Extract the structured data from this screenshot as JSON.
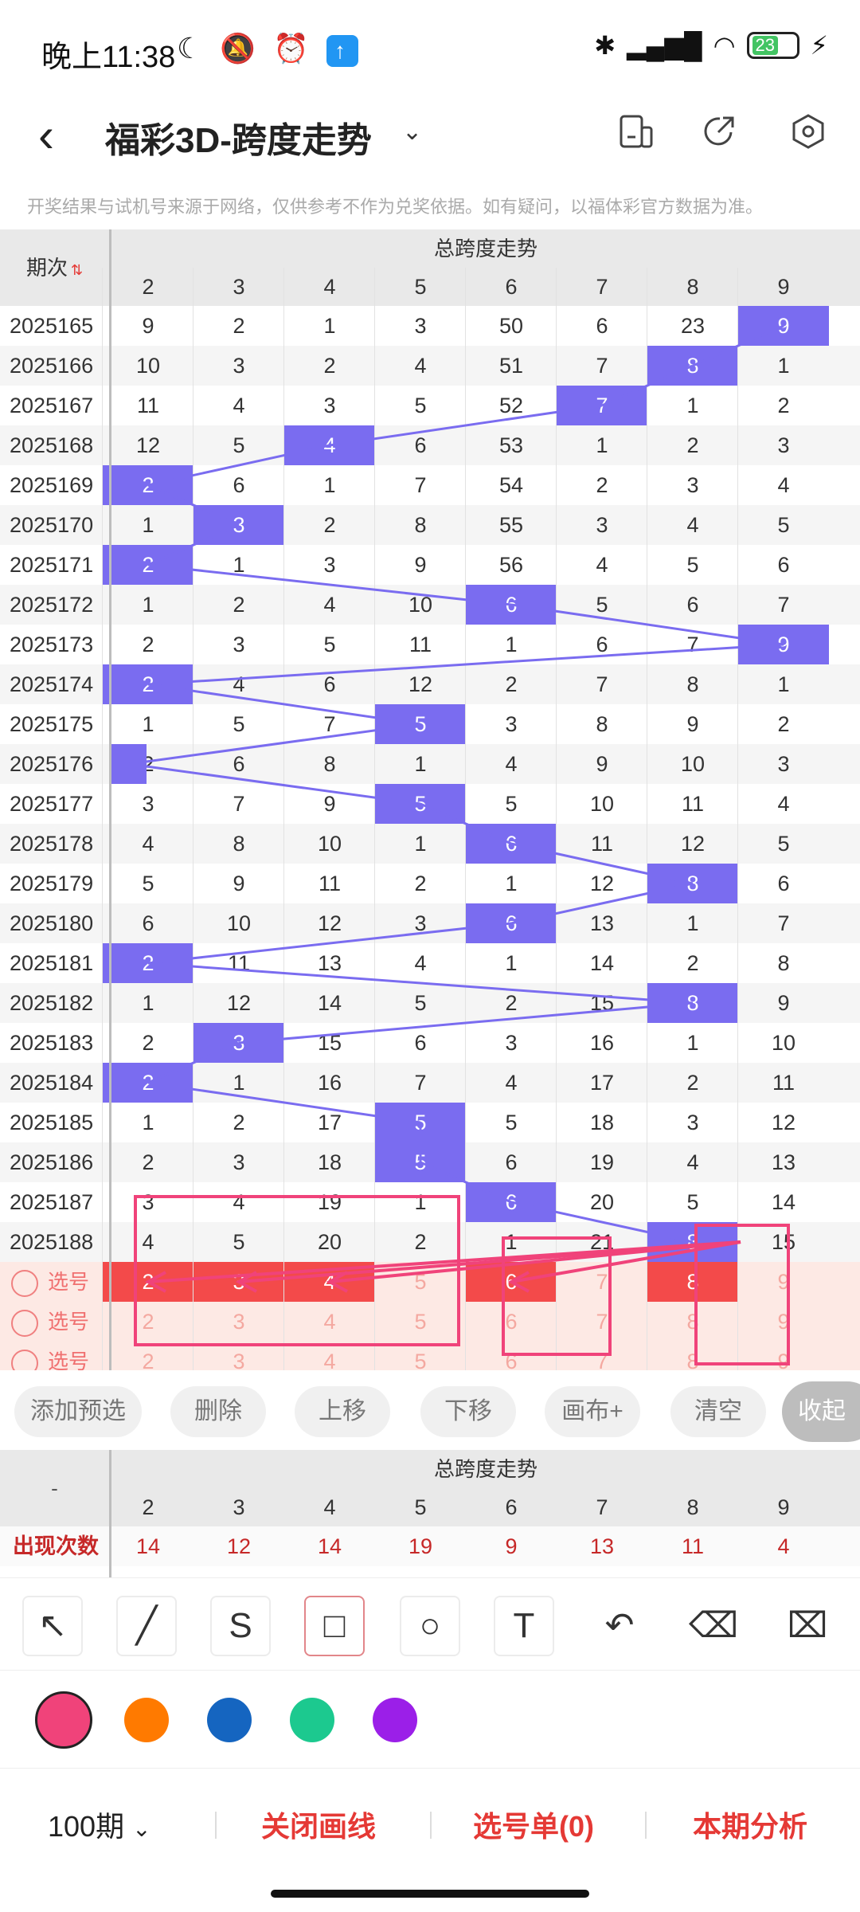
{
  "status": {
    "time": "晚上11:38",
    "battery": "23"
  },
  "header": {
    "title": "福彩3D-跨度走势"
  },
  "notice": "开奖结果与试机号来源于网络，仅供参考不作为兑奖依据。如有疑问，以福体彩官方数据为准。",
  "grid": {
    "title": "总跨度走势",
    "period_label": "期次",
    "columns": [
      "2",
      "3",
      "4",
      "5",
      "6",
      "7",
      "8",
      "9"
    ],
    "rows": [
      {
        "period": "2025165",
        "values": [
          "9",
          "2",
          "1",
          "3",
          "50",
          "6",
          "23",
          "9"
        ],
        "hit": 7
      },
      {
        "period": "2025166",
        "values": [
          "10",
          "3",
          "2",
          "4",
          "51",
          "7",
          "8",
          "1"
        ],
        "hit": 6
      },
      {
        "period": "2025167",
        "values": [
          "11",
          "4",
          "3",
          "5",
          "52",
          "7",
          "1",
          "2"
        ],
        "hit": 5
      },
      {
        "period": "2025168",
        "values": [
          "12",
          "5",
          "4",
          "6",
          "53",
          "1",
          "2",
          "3"
        ],
        "hit": 2
      },
      {
        "period": "2025169",
        "values": [
          "2",
          "6",
          "1",
          "7",
          "54",
          "2",
          "3",
          "4"
        ],
        "hit": 0
      },
      {
        "period": "2025170",
        "values": [
          "1",
          "3",
          "2",
          "8",
          "55",
          "3",
          "4",
          "5"
        ],
        "hit": 1
      },
      {
        "period": "2025171",
        "values": [
          "2",
          "1",
          "3",
          "9",
          "56",
          "4",
          "5",
          "6"
        ],
        "hit": 0
      },
      {
        "period": "2025172",
        "values": [
          "1",
          "2",
          "4",
          "10",
          "6",
          "5",
          "6",
          "7"
        ],
        "hit": 4
      },
      {
        "period": "2025173",
        "values": [
          "2",
          "3",
          "5",
          "11",
          "1",
          "6",
          "7",
          "9"
        ],
        "hit": 7
      },
      {
        "period": "2025174",
        "values": [
          "2",
          "4",
          "6",
          "12",
          "2",
          "7",
          "8",
          "1"
        ],
        "hit": 0
      },
      {
        "period": "2025175",
        "values": [
          "1",
          "5",
          "7",
          "5",
          "3",
          "8",
          "9",
          "2"
        ],
        "hit": 3
      },
      {
        "period": "2025176",
        "values": [
          "2",
          "6",
          "8",
          "1",
          "4",
          "9",
          "10",
          "3"
        ],
        "hit": -1
      },
      {
        "period": "2025177",
        "values": [
          "3",
          "7",
          "9",
          "5",
          "5",
          "10",
          "11",
          "4"
        ],
        "hit": 3
      },
      {
        "period": "2025178",
        "values": [
          "4",
          "8",
          "10",
          "1",
          "6",
          "11",
          "12",
          "5"
        ],
        "hit": 4
      },
      {
        "period": "2025179",
        "values": [
          "5",
          "9",
          "11",
          "2",
          "1",
          "12",
          "8",
          "6"
        ],
        "hit": 6
      },
      {
        "period": "2025180",
        "values": [
          "6",
          "10",
          "12",
          "3",
          "6",
          "13",
          "1",
          "7"
        ],
        "hit": 4
      },
      {
        "period": "2025181",
        "values": [
          "2",
          "11",
          "13",
          "4",
          "1",
          "14",
          "2",
          "8"
        ],
        "hit": 0
      },
      {
        "period": "2025182",
        "values": [
          "1",
          "12",
          "14",
          "5",
          "2",
          "15",
          "8",
          "9"
        ],
        "hit": 6
      },
      {
        "period": "2025183",
        "values": [
          "2",
          "3",
          "15",
          "6",
          "3",
          "16",
          "1",
          "10"
        ],
        "hit": 1
      },
      {
        "period": "2025184",
        "values": [
          "2",
          "1",
          "16",
          "7",
          "4",
          "17",
          "2",
          "11"
        ],
        "hit": 0
      },
      {
        "period": "2025185",
        "values": [
          "1",
          "2",
          "17",
          "5",
          "5",
          "18",
          "3",
          "12"
        ],
        "hit": 3
      },
      {
        "period": "2025186",
        "values": [
          "2",
          "3",
          "18",
          "5",
          "6",
          "19",
          "4",
          "13"
        ],
        "hit": 3
      },
      {
        "period": "2025187",
        "values": [
          "3",
          "4",
          "19",
          "1",
          "6",
          "20",
          "5",
          "14"
        ],
        "hit": 4
      },
      {
        "period": "2025188",
        "values": [
          "4",
          "5",
          "20",
          "2",
          "1",
          "21",
          "8",
          "15"
        ],
        "hit": 6
      }
    ],
    "pick_label": "选号",
    "pick_values": [
      "2",
      "3",
      "4",
      "5",
      "6",
      "7",
      "8",
      "9"
    ],
    "pick_selected": [
      0,
      1,
      2,
      4,
      6
    ]
  },
  "actions": [
    "添加预选",
    "删除",
    "上移",
    "下移",
    "画布+",
    "清空",
    "收起"
  ],
  "stats": {
    "title": "总跨度走势",
    "corner": "-",
    "row_label": "出现次数",
    "values": [
      "14",
      "12",
      "14",
      "19",
      "9",
      "13",
      "11",
      "4"
    ]
  },
  "tools": [
    "arrow-tool",
    "line-tool",
    "freehand-tool",
    "rectangle-tool",
    "circle-tool",
    "text-tool",
    "undo-tool",
    "eraser-tool",
    "clear-tool"
  ],
  "colors": [
    "#f0437a",
    "#ff7a00",
    "#1565c0",
    "#1cc98f",
    "#9b1fe8"
  ],
  "bottom": {
    "periods": "100期",
    "close_lines": "关闭画线",
    "pick_list": "选号单(0)",
    "analysis": "本期分析"
  }
}
